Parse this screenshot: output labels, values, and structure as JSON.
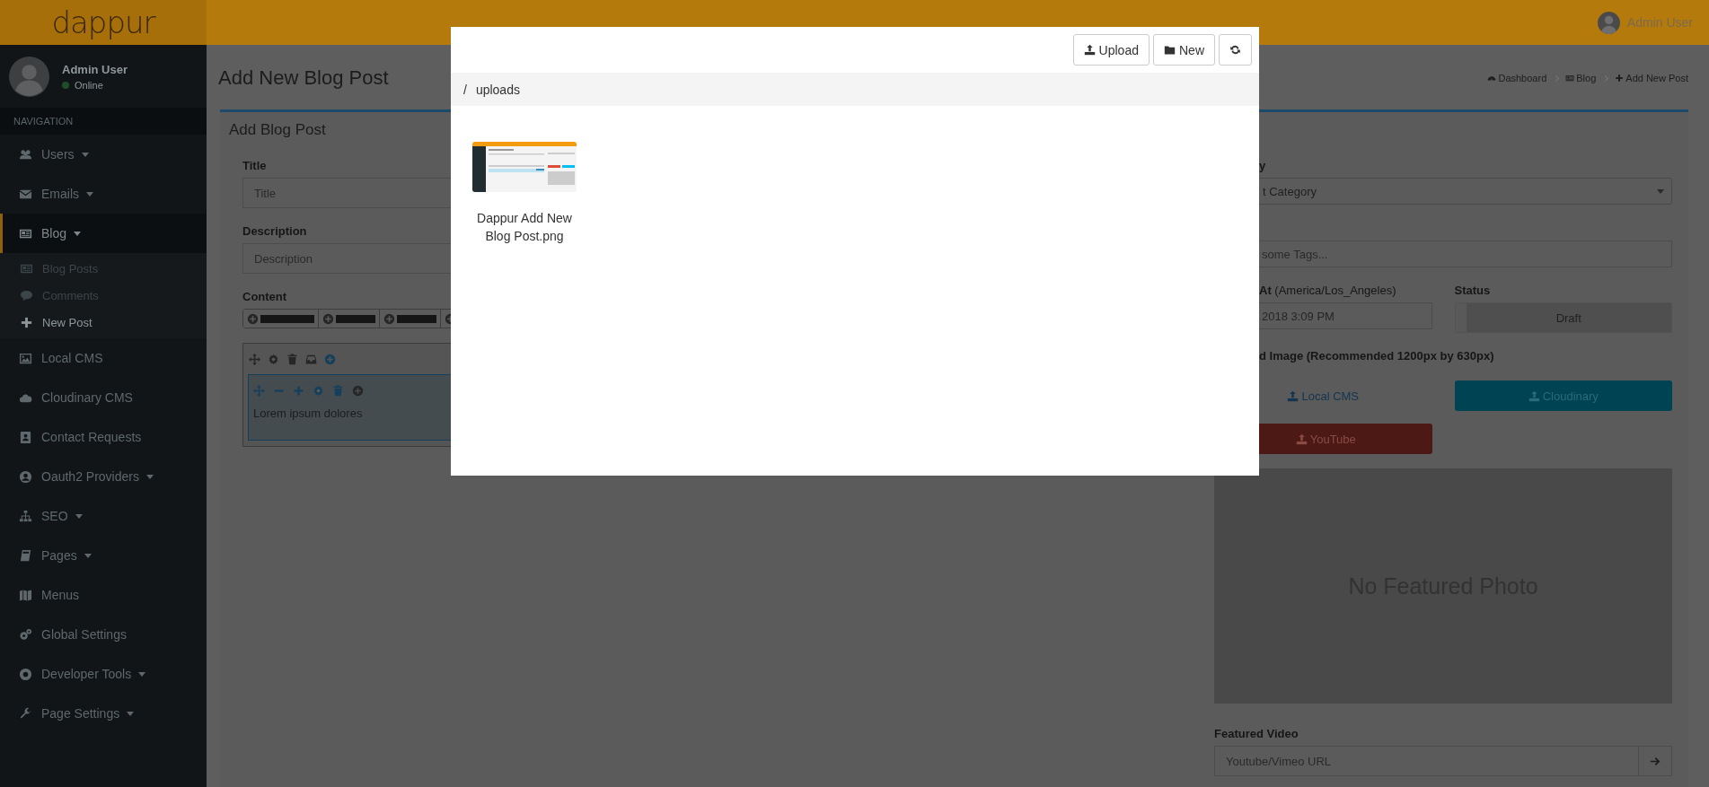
{
  "header": {
    "logo": "dappur",
    "user": "Admin User"
  },
  "sidebar": {
    "user": {
      "name": "Admin User",
      "status": "Online",
      "online": true
    },
    "nav_header": "NAVIGATION",
    "items": [
      {
        "label": "Users",
        "dropdown": true,
        "selected": false
      },
      {
        "label": "Emails",
        "dropdown": true,
        "selected": false
      },
      {
        "label": "Blog",
        "dropdown": true,
        "selected": true,
        "children": [
          {
            "label": "Blog Posts",
            "selected": false
          },
          {
            "label": "Comments",
            "selected": false
          },
          {
            "label": "New Post",
            "selected": true
          }
        ]
      },
      {
        "label": "Local CMS",
        "dropdown": false,
        "selected": false
      },
      {
        "label": "Cloudinary CMS",
        "dropdown": false,
        "selected": false
      },
      {
        "label": "Contact Requests",
        "dropdown": false,
        "selected": false
      },
      {
        "label": "Oauth2 Providers",
        "dropdown": true,
        "selected": false
      },
      {
        "label": "SEO",
        "dropdown": true,
        "selected": false
      },
      {
        "label": "Pages",
        "dropdown": true,
        "selected": false
      },
      {
        "label": "Menus",
        "dropdown": false,
        "selected": false
      },
      {
        "label": "Global Settings",
        "dropdown": false,
        "selected": false
      },
      {
        "label": "Developer Tools",
        "dropdown": true,
        "selected": false
      },
      {
        "label": "Page Settings",
        "dropdown": true,
        "selected": false
      }
    ]
  },
  "page": {
    "title": "Add New Blog Post",
    "breadcrumb": [
      {
        "label": "Dashboard"
      },
      {
        "label": "Blog"
      },
      {
        "label": "Add New Post"
      }
    ]
  },
  "form": {
    "box_title": "Add Blog Post",
    "fields": [
      {
        "label": "Title",
        "placeholder": "Title"
      },
      {
        "label": "Description",
        "placeholder": "Description"
      }
    ],
    "content_label": "Content",
    "editor_text": "Lorem ipsum dolores",
    "category": {
      "label": "y",
      "value": "t Category"
    },
    "tags": {
      "placeholder": "some Tags..."
    },
    "publish": {
      "label_bold": "At",
      "label_rest": "(America/Los_Angeles)",
      "value": "2018 3:09 PM"
    },
    "status": {
      "label": "Status",
      "value": "Draft"
    },
    "featured_image": {
      "label": "d Image (Recommended 1200px by 630px)",
      "placeholder_text": "No Featured Photo",
      "buttons": [
        {
          "label": "Local CMS",
          "kind": "link"
        },
        {
          "label": "Cloudinary",
          "kind": "info"
        },
        {
          "label": "YouTube",
          "kind": "danger"
        }
      ]
    },
    "featured_video": {
      "label": "Featured Video",
      "placeholder": "Youtube/Vimeo URL"
    }
  },
  "modal": {
    "buttons": [
      {
        "label": "Upload",
        "kind": "upload"
      },
      {
        "label": "New",
        "kind": "folder"
      },
      {
        "kind": "refresh"
      }
    ],
    "path": {
      "separator": "/",
      "folder": "uploads"
    },
    "files": [
      {
        "name": "Dappur Add New Blog Post.png",
        "kind": "picture"
      }
    ]
  }
}
